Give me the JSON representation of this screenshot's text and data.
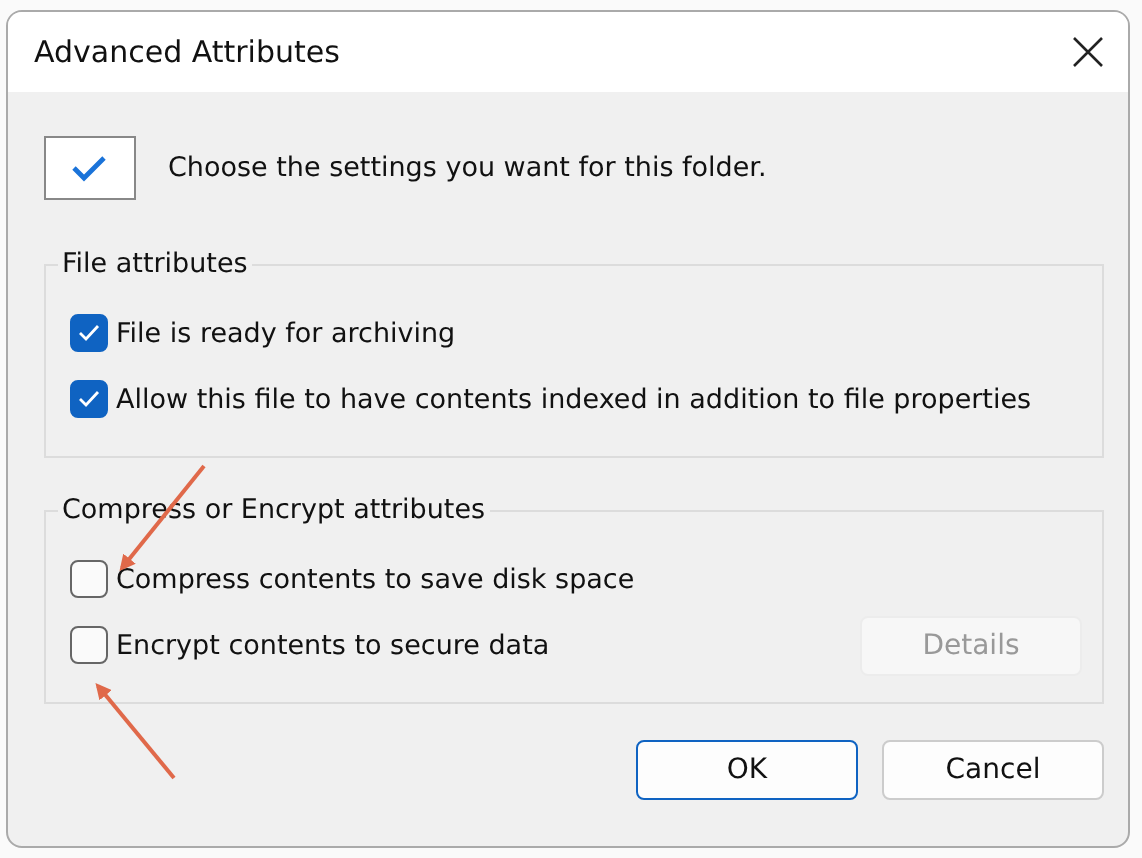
{
  "window": {
    "title": "Advanced Attributes"
  },
  "intro": {
    "text": "Choose the settings you want for this folder."
  },
  "file_attributes": {
    "label": "File attributes",
    "options": [
      {
        "label": "File is ready for archiving",
        "checked": true
      },
      {
        "label": "Allow this file to have contents indexed in addition to file properties",
        "checked": true
      }
    ]
  },
  "compress_encrypt": {
    "label": "Compress or Encrypt attributes",
    "options": [
      {
        "label": "Compress contents to save disk space",
        "checked": false
      },
      {
        "label": "Encrypt contents to secure data",
        "checked": false
      }
    ],
    "details_button": {
      "label": "Details",
      "disabled": true
    }
  },
  "buttons": [
    {
      "label": "OK",
      "default": true
    },
    {
      "label": "Cancel",
      "default": false
    }
  ]
}
